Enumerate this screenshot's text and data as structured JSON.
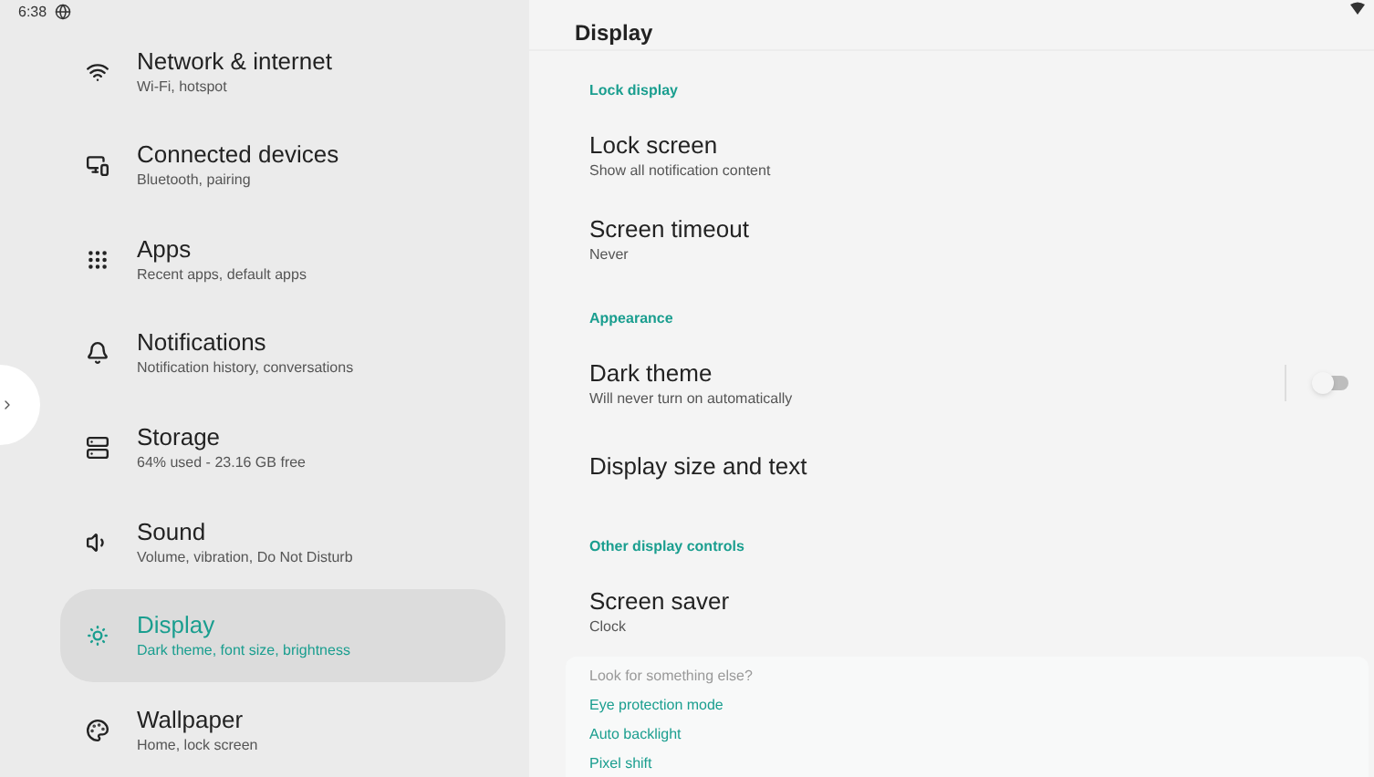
{
  "status_bar": {
    "time": "6:38"
  },
  "sidebar": {
    "items": [
      {
        "title": "Network & internet",
        "subtitle": "Wi-Fi, hotspot",
        "selected": false
      },
      {
        "title": "Connected devices",
        "subtitle": "Bluetooth, pairing",
        "selected": false
      },
      {
        "title": "Apps",
        "subtitle": "Recent apps, default apps",
        "selected": false
      },
      {
        "title": "Notifications",
        "subtitle": "Notification history, conversations",
        "selected": false
      },
      {
        "title": "Storage",
        "subtitle": "64% used - 23.16 GB free",
        "selected": false
      },
      {
        "title": "Sound",
        "subtitle": "Volume, vibration, Do Not Disturb",
        "selected": false
      },
      {
        "title": "Display",
        "subtitle": "Dark theme, font size, brightness",
        "selected": true
      },
      {
        "title": "Wallpaper",
        "subtitle": "Home, lock screen",
        "selected": false
      }
    ]
  },
  "page": {
    "title": "Display",
    "rows": [
      {
        "kind": "header",
        "title": "Lock display"
      },
      {
        "kind": "item",
        "title": "Lock screen",
        "subtitle": "Show all notification content"
      },
      {
        "kind": "item",
        "title": "Screen timeout",
        "subtitle": "Never"
      },
      {
        "kind": "header",
        "title": "Appearance"
      },
      {
        "kind": "toggle",
        "title": "Dark theme",
        "subtitle": "Will never turn on automatically",
        "on": false
      },
      {
        "kind": "item",
        "title": "Display size and text"
      },
      {
        "kind": "header",
        "title": "Other display controls"
      },
      {
        "kind": "item",
        "title": "Screen saver",
        "subtitle": "Clock"
      }
    ],
    "suggestions": {
      "title": "Look for something else?",
      "links": [
        "Eye protection mode",
        "Auto backlight",
        "Pixel shift"
      ]
    }
  }
}
